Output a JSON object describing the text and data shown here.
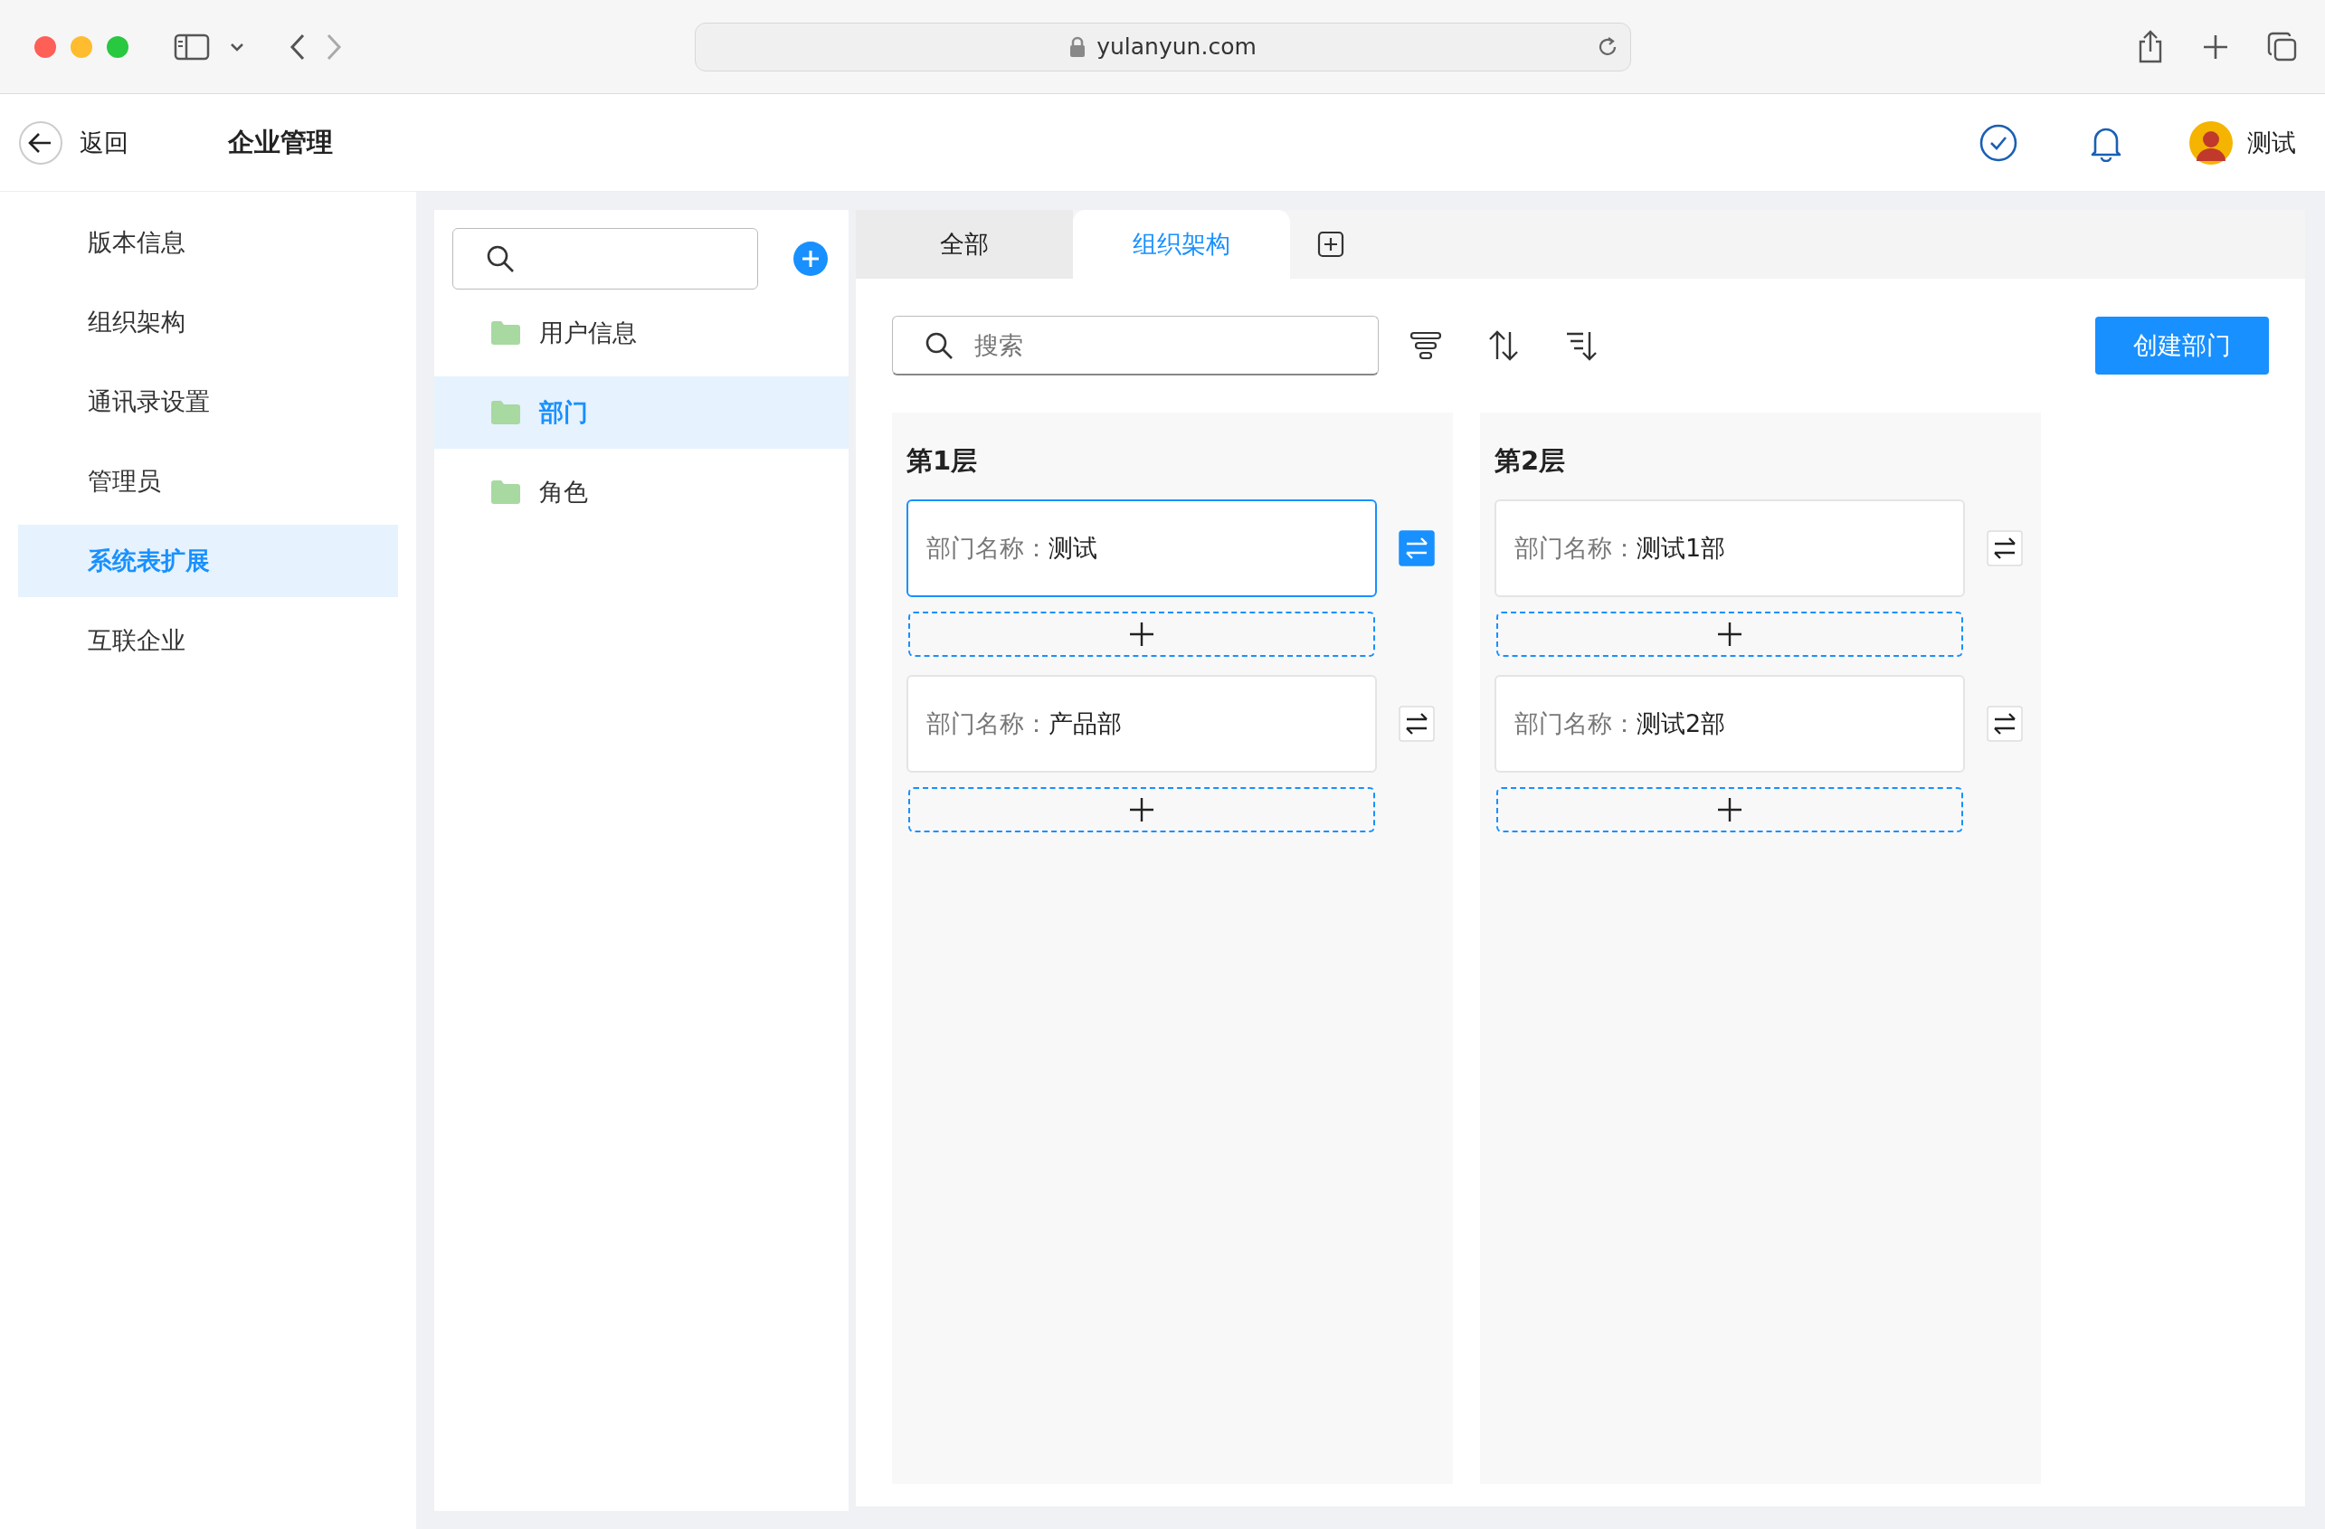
{
  "browser": {
    "url": "yulanyun.com"
  },
  "header": {
    "back_label": "返回",
    "title": "企业管理",
    "user_name": "测试"
  },
  "sidebar": {
    "items": [
      {
        "label": "版本信息",
        "selected": false
      },
      {
        "label": "组织架构",
        "selected": false
      },
      {
        "label": "通讯录设置",
        "selected": false
      },
      {
        "label": "管理员",
        "selected": false
      },
      {
        "label": "系统表扩展",
        "selected": true
      },
      {
        "label": "互联企业",
        "selected": false
      }
    ]
  },
  "folders": {
    "items": [
      {
        "label": "用户信息",
        "selected": false
      },
      {
        "label": "部门",
        "selected": true
      },
      {
        "label": "角色",
        "selected": false
      }
    ]
  },
  "tabs": [
    {
      "label": "全部",
      "selected": false
    },
    {
      "label": "组织架构",
      "selected": true
    }
  ],
  "toolbar": {
    "search_placeholder": "搜索",
    "create_button": "创建部门"
  },
  "levels": [
    {
      "title": "第1层",
      "departments": [
        {
          "label": "部门名称：",
          "name": "测试",
          "selected": true
        },
        {
          "label": "部门名称：",
          "name": "产品部",
          "selected": false
        }
      ]
    },
    {
      "title": "第2层",
      "departments": [
        {
          "label": "部门名称：",
          "name": "测试1部",
          "selected": false
        },
        {
          "label": "部门名称：",
          "name": "测试2部",
          "selected": false
        }
      ]
    }
  ]
}
